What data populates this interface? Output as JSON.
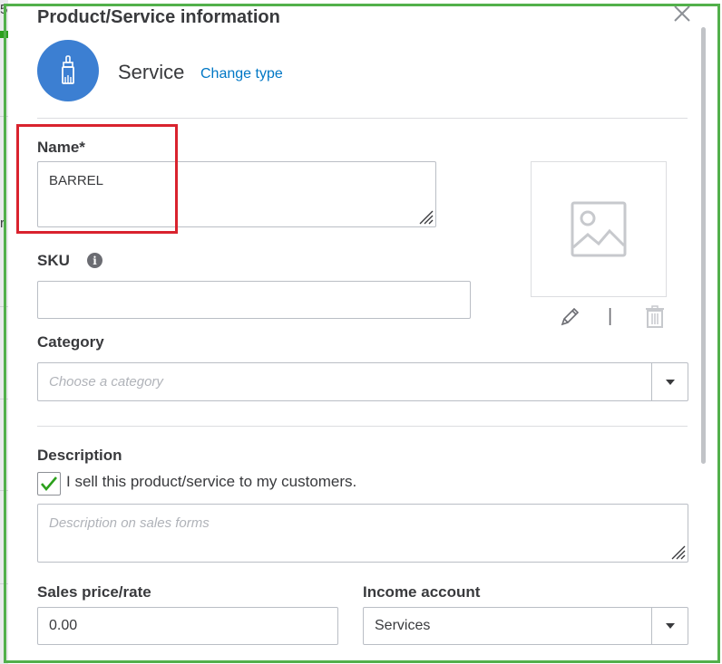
{
  "dialog": {
    "title": "Product/Service information",
    "type_label": "Service",
    "change_type_link": "Change type"
  },
  "form": {
    "name": {
      "label": "Name*",
      "value": "BARREL"
    },
    "sku": {
      "label": "SKU",
      "value": "",
      "info_icon_glyph": "i"
    },
    "category": {
      "label": "Category",
      "placeholder": "Choose a category"
    },
    "description": {
      "label": "Description",
      "sell_checkbox_label": "I sell this product/service to my customers.",
      "sell_checked": true,
      "sales_placeholder": "Description on sales forms"
    },
    "sales_price": {
      "label": "Sales price/rate",
      "value": "0.00"
    },
    "income_account": {
      "label": "Income account",
      "value": "Services"
    }
  },
  "image_actions": {
    "separator": "|"
  },
  "icons": {
    "type_icon": "paintbrush-icon",
    "close": "close-icon",
    "image_placeholder": "image-placeholder-icon",
    "edit": "pencil-icon",
    "delete": "trash-icon",
    "info": "info-icon",
    "check": "checkmark-icon"
  },
  "colors": {
    "accent_blue": "#3c7fd2",
    "link_blue": "#0077c5",
    "check_green": "#2ca01c",
    "highlight_red": "#d9232e",
    "frame_green": "#52b04b"
  }
}
